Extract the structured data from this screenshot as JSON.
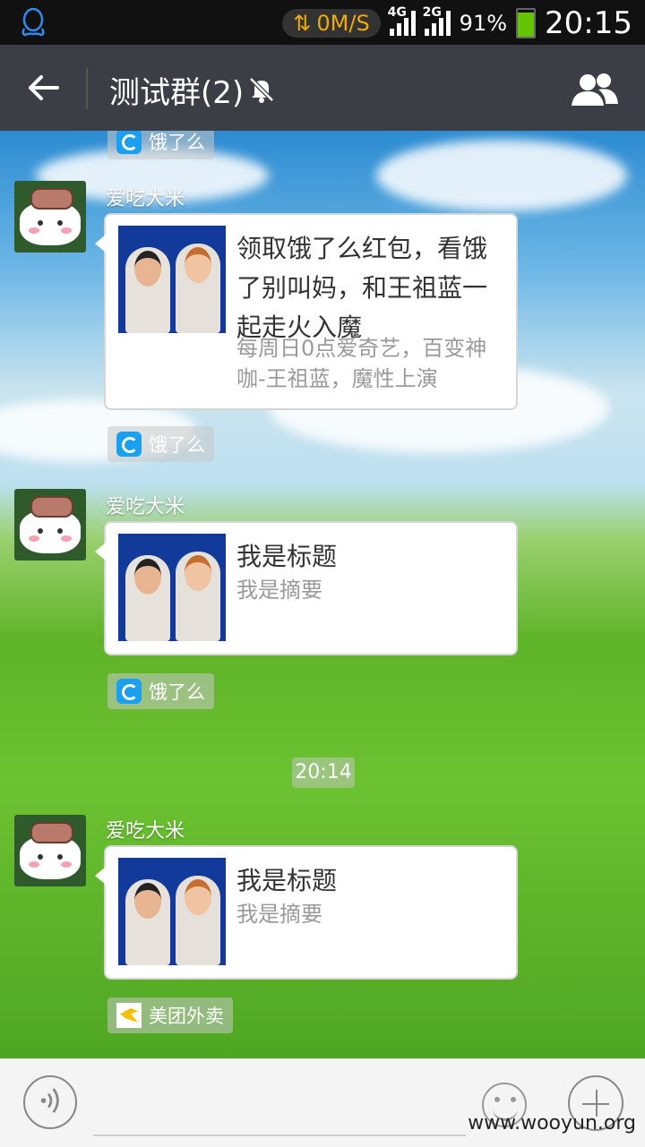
{
  "status_bar": {
    "speed": "0M/S",
    "net1": "4G",
    "net2": "4G",
    "net3": "2G",
    "battery": "91%",
    "time": "20:15",
    "accent_color": "#f2a900"
  },
  "header": {
    "title": "测试群(2)",
    "back_icon": "arrow-left-icon",
    "mute_icon": "bell-off-icon",
    "members_icon": "group-icon"
  },
  "messages": [
    {
      "source": "饿了么"
    },
    {
      "sender": "爱吃大米",
      "title": "领取饿了么红包，看饿了别叫妈，和王祖蓝一起走火入魔",
      "summary": "每周日0点爱奇艺，百变神咖-王祖蓝，魔性上演",
      "source": "饿了么"
    },
    {
      "sender": "爱吃大米",
      "title": "我是标题",
      "summary": "我是摘要",
      "source": "饿了么"
    },
    {
      "timestamp": "20:14"
    },
    {
      "sender": "爱吃大米",
      "title": "我是标题",
      "summary": "我是摘要",
      "source": "美团外卖"
    }
  ],
  "input_bar": {
    "placeholder": "",
    "voice_icon": "voice-icon",
    "emoji_icon": "emoji-icon",
    "plus_icon": "plus-icon"
  },
  "watermark": "www.wooyun.org"
}
